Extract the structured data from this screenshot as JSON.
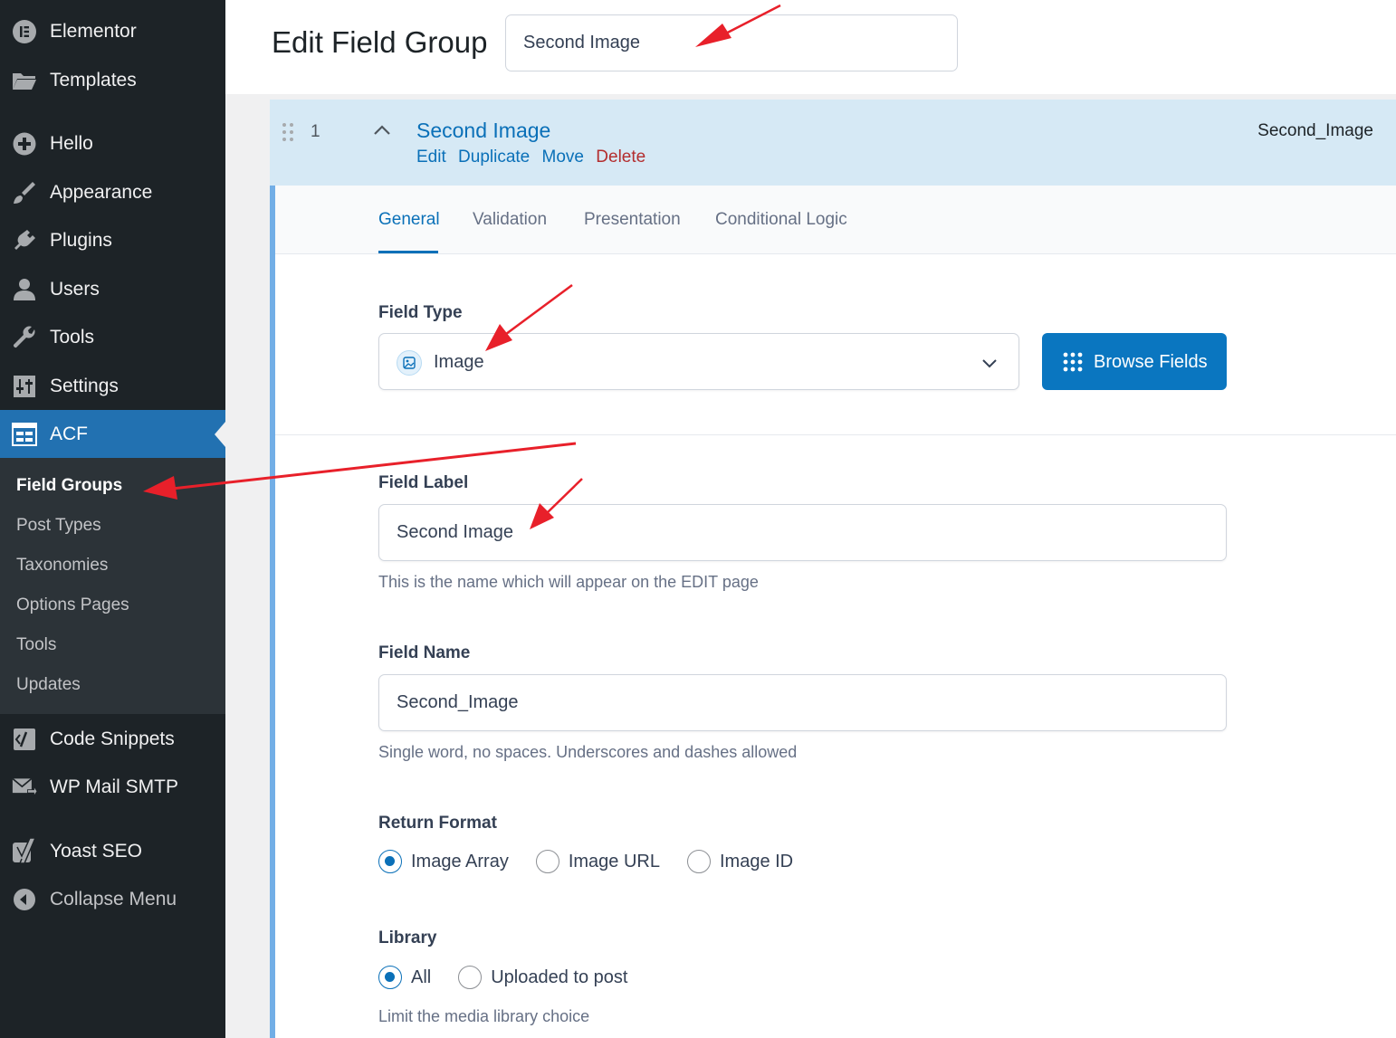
{
  "sidebar": {
    "top_items": [
      {
        "label": "Elementor",
        "icon": "elementor-icon"
      },
      {
        "label": "Templates",
        "icon": "folder-icon"
      },
      {
        "label": "Hello",
        "icon": "plus-circle-icon"
      },
      {
        "label": "Appearance",
        "icon": "paintbrush-icon"
      },
      {
        "label": "Plugins",
        "icon": "plug-icon"
      },
      {
        "label": "Users",
        "icon": "user-icon"
      },
      {
        "label": "Tools",
        "icon": "wrench-icon"
      },
      {
        "label": "Settings",
        "icon": "sliders-icon"
      },
      {
        "label": "ACF",
        "icon": "acf-icon"
      }
    ],
    "submenu": [
      "Field Groups",
      "Post Types",
      "Taxonomies",
      "Options Pages",
      "Tools",
      "Updates"
    ],
    "bottom_items": [
      {
        "label": "Code Snippets",
        "icon": "code-icon"
      },
      {
        "label": "WP Mail SMTP",
        "icon": "mail-icon"
      },
      {
        "label": "Yoast SEO",
        "icon": "yoast-icon"
      },
      {
        "label": "Collapse Menu",
        "icon": "collapse-icon"
      }
    ]
  },
  "header": {
    "title": "Edit Field Group",
    "group_title_value": "Second Image"
  },
  "field": {
    "order": "1",
    "label": "Second Image",
    "name": "Second_Image",
    "actions": {
      "edit": "Edit",
      "duplicate": "Duplicate",
      "move": "Move",
      "delete": "Delete"
    },
    "tabs": [
      "General",
      "Validation",
      "Presentation",
      "Conditional Logic"
    ],
    "general": {
      "field_type_label": "Field Type",
      "field_type_value": "Image",
      "browse_button": "Browse Fields",
      "field_label_label": "Field Label",
      "field_label_value": "Second Image",
      "field_label_help": "This is the name which will appear on the EDIT page",
      "field_name_label": "Field Name",
      "field_name_value": "Second_Image",
      "field_name_help": "Single word, no spaces. Underscores and dashes allowed",
      "return_format_label": "Return Format",
      "return_format_options": [
        "Image Array",
        "Image URL",
        "Image ID"
      ],
      "return_format_selected": "Image Array",
      "library_label": "Library",
      "library_options": [
        "All",
        "Uploaded to post"
      ],
      "library_selected": "All",
      "library_help": "Limit the media library choice"
    }
  },
  "colors": {
    "sidebar_bg": "#1d2327",
    "submenu_bg": "#2c3338",
    "accent": "#2271b1",
    "link": "#0a70b8",
    "delete": "#b32d2e",
    "field_head_bg": "#d6e9f5",
    "annotation": "#e8202a"
  }
}
